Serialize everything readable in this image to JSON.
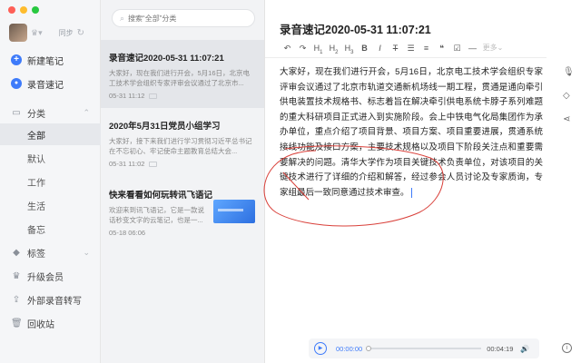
{
  "sidebar": {
    "sync_label": "同步",
    "new_note": "新建笔记",
    "record_note": "录音速记",
    "category": "分类",
    "category_items": [
      "全部",
      "默认",
      "工作",
      "生活",
      "备忘"
    ],
    "tags": "标签",
    "upgrade": "升级会员",
    "transcribe": "外部录音转写",
    "trash": "回收站"
  },
  "list": {
    "search_placeholder": "搜索“全部”分类",
    "cards": [
      {
        "title": "录音速记2020-05-31 11:07:21",
        "body": "大家好，现在我们进行开会，5月16日，北京电工技术学会组织专家评审会议通过了北京市...",
        "date": "05-31 11:12"
      },
      {
        "title": "2020年5月31日党员小组学习",
        "body": "大家好，接下来我们进行学习贯彻习近平总书记在不忘初心、牢记使命主题教育总结大会...",
        "date": "05-31 11:02"
      },
      {
        "title": "快来看看如何玩转讯飞语记",
        "body": "欢迎来到讯飞语记，它是一款说话秒变文字的云笔记，也是一...",
        "date": "05-18 06:06"
      }
    ]
  },
  "editor": {
    "title": "录音速记2020-05-31 11:07:21",
    "toolbar_more": "更多",
    "content": "大家好，现在我们进行开会，5月16日，北京电工技术学会组织专家评审会议通过了北京市轨道交通新机场线一期工程，贯通是通向牵引供电装置技术规格书、标志着旨在解决牵引供电系统卡脖子系列难题的重大科研项目正式进入到实施阶段。会上中铁电气化局集团作为承办单位，重点介绍了项目背景、项目方案、项目重要进展，贯通系统接线功能及接口方案，主要技术规格以及项目下阶段关注点和重要需要解决的问题。清华大学作为项目关键技术负责单位，对该项目的关键技术进行了详细的介绍和解答，经过参会人员讨论及专家质询，专家组最后一致同意通过技术审查。"
  },
  "player": {
    "current_time": "00:00:00",
    "total_time": "00:04:19",
    "progress": 0
  },
  "colors": {
    "accent": "#3e7bfa",
    "annotation": "#d9403a"
  }
}
